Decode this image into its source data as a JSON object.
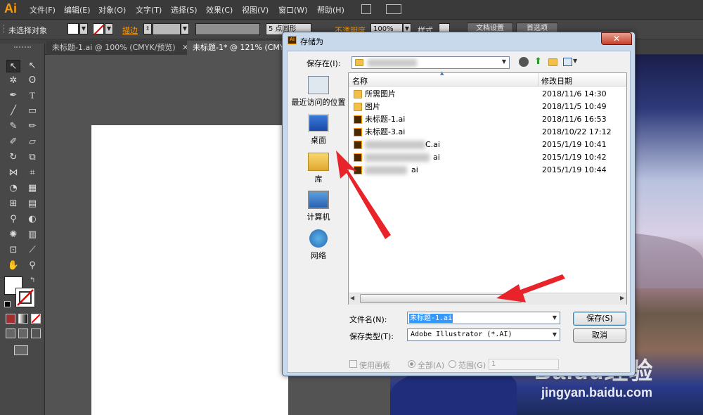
{
  "app": {
    "logo": "Ai"
  },
  "menu": [
    "文件(F)",
    "编辑(E)",
    "对象(O)",
    "文字(T)",
    "选择(S)",
    "效果(C)",
    "视图(V)",
    "窗口(W)",
    "帮助(H)"
  ],
  "control_bar": {
    "selection": "未选择对象",
    "stroke_label": "描边",
    "brush": "5 点圆形",
    "opacity_label": "不透明度",
    "opacity_value": "100%",
    "style_label": "样式",
    "doc_setup": "文档设置",
    "prefs": "首选项"
  },
  "tabs": [
    "未标题-1.ai @ 100% (CMYK/预览)",
    "未标题-1* @ 121% (CMYK/预览)"
  ],
  "dialog": {
    "title": "存储为",
    "close": "✕",
    "save_in_label": "保存在(I):",
    "places": [
      "最近访问的位置",
      "桌面",
      "库",
      "计算机",
      "网络"
    ],
    "columns": {
      "name": "名称",
      "date": "修改日期"
    },
    "files": [
      {
        "name": "所需图片",
        "date": "2018/11/6 14:30",
        "kind": "folder"
      },
      {
        "name": "图片",
        "date": "2018/11/5 10:49",
        "kind": "folder"
      },
      {
        "name": "未标题-1.ai",
        "date": "2018/11/6 16:53",
        "kind": "ai"
      },
      {
        "name": "未标题-3.ai",
        "date": "2018/10/22 17:12",
        "kind": "ai"
      },
      {
        "name": "C.ai",
        "date": "2015/1/19 10:41",
        "kind": "ai"
      },
      {
        "name": "ai",
        "date": "2015/1/19 10:42",
        "kind": "ai"
      },
      {
        "name": "ai",
        "date": "2015/1/19 10:44",
        "kind": "ai"
      }
    ],
    "filename_label": "文件名(N):",
    "filename_value": "未标题-1.ai",
    "filetype_label": "保存类型(T):",
    "filetype_value": "Adobe Illustrator (*.AI)",
    "save_button": "保存(S)",
    "cancel_button": "取消",
    "use_artboards": "使用画板",
    "all_label": "全部(A)",
    "range_label": "范围(G)",
    "range_value": "1"
  },
  "watermark": {
    "brand": "Baidu经验",
    "url": "jingyan.baidu.com"
  },
  "colors": {
    "accent": "#ff9a00",
    "annotation_red": "#e8242a",
    "selection": "#3399ff"
  }
}
